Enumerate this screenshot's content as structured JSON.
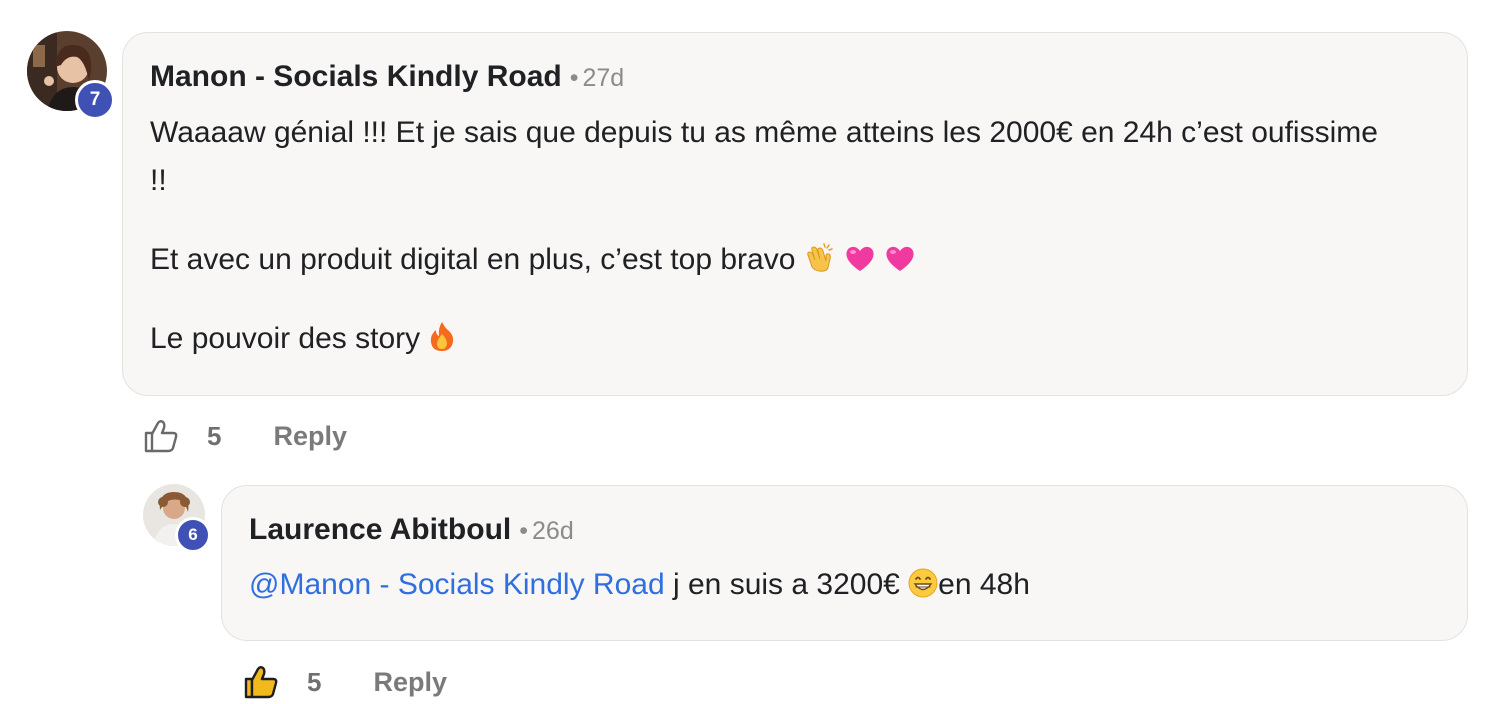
{
  "comments": [
    {
      "author": "Manon - Socials Kindly Road",
      "separator": "•",
      "time": "27d",
      "level": "7",
      "paragraphs": [
        "Waaaaw génial !!! Et je sais que depuis tu as même atteins les 2000€ en 24h c’est oufissime",
        "!!",
        "Et avec un produit digital en plus, c’est top bravo",
        "Le pouvoir des story"
      ],
      "emojis": [
        "clapping-hands",
        "pink-heart",
        "pink-heart",
        "fire"
      ],
      "likes": "5",
      "reply_label": "Reply",
      "liked": false
    },
    {
      "author": "Laurence Abitboul",
      "separator": "•",
      "time": "26d",
      "level": "6",
      "mention": "@Manon - Socials Kindly Road",
      "text_before_emoji": " j en suis a 3200€ ",
      "text_after_emoji": "en 48h",
      "emojis": [
        "grinning-face"
      ],
      "likes": "5",
      "reply_label": "Reply",
      "liked": true
    }
  ],
  "colors": {
    "badge": "#3f51b5",
    "mention": "#2f6fdf",
    "bubble_bg": "#f8f7f5",
    "bubble_border": "#e4e2df",
    "muted": "#7a7a7a"
  }
}
